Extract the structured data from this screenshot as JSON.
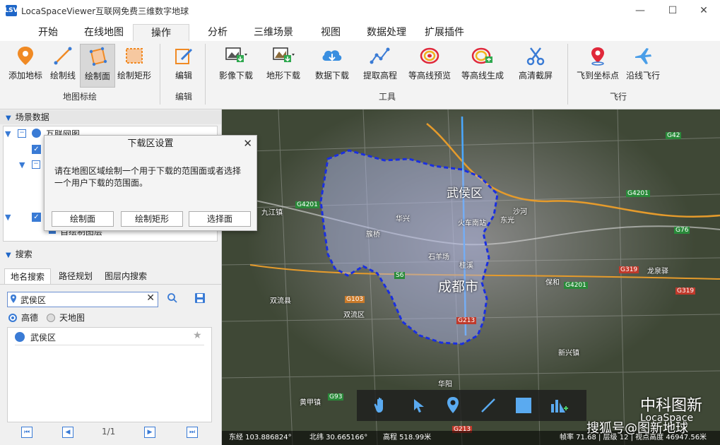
{
  "window": {
    "logo": "LSV",
    "title": "LocaSpaceViewer互联网免费三维数字地球"
  },
  "tabs": [
    "开始",
    "在线地图",
    "操作",
    "分析",
    "三维场景",
    "视图",
    "数据处理",
    "扩展插件"
  ],
  "ribbon": {
    "groups": {
      "annotate": "地图标绘",
      "edit": "编辑",
      "tools": "工具",
      "fly": "飞行"
    },
    "buttons": {
      "add_marker": "添加地标",
      "draw_line": "绘制线",
      "draw_polygon": "绘制面",
      "draw_rect": "绘制矩形",
      "edit": "编辑",
      "image_download": "影像下载",
      "terrain_download": "地形下载",
      "data_download": "数据下载",
      "extract_elevation": "提取高程",
      "contour_preview": "等高线预览",
      "contour_generate": "等高线生成",
      "hd_capture": "高清截屏",
      "fly_to_coord": "飞到坐标点",
      "fly_along_line": "沿线飞行"
    }
  },
  "left": {
    "scene_header": "场景数据",
    "tree_items": [
      "互联网图",
      "",
      "",
      "自绘制图层"
    ],
    "search_header": "搜索",
    "search_tabs": [
      "地名搜索",
      "路径规划",
      "图层内搜索"
    ],
    "search_value": "武侯区",
    "providers": [
      "高德",
      "天地图"
    ],
    "result": "武侯区",
    "page": "1/1"
  },
  "dialog": {
    "title": "下载区设置",
    "message": "请在地图区域绘制一个用于下载的范围面或者选择一个用户下载的范围面。",
    "buttons": [
      "绘制面",
      "绘制矩形",
      "选择面"
    ]
  },
  "map": {
    "labels": [
      "武侯区",
      "成都市",
      "九江镇",
      "双流县",
      "双流区",
      "华兴",
      "簇桥",
      "石羊场",
      "桂溪",
      "火车南站",
      "东光",
      "沙河",
      "保和",
      "龙泉驿",
      "新兴镇",
      "黄甲镇",
      "华阳"
    ],
    "road_badges": [
      "G4201",
      "G4201",
      "G4201",
      "G42",
      "G76",
      "G319",
      "G319",
      "G93",
      "S6",
      "G103",
      "G213",
      "G213"
    ]
  },
  "status": {
    "lon": "东经 103.886824°",
    "lat": "北纬 30.665166°",
    "alt": "高程 518.99米",
    "right": "帧率 71.68 | 层级 12 | 视点高度 46947.56米"
  },
  "watermarks": {
    "brand": "中科图新",
    "sub": "LocaSpace",
    "sohu": "搜狐号@图新地球"
  }
}
